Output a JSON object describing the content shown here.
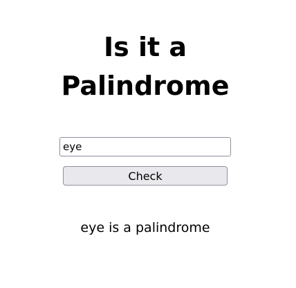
{
  "page": {
    "title_line1": "Is it a",
    "title_line2": "Palindrome"
  },
  "form": {
    "input_value": "eye",
    "check_label": "Check"
  },
  "result": {
    "text": "eye is a palindrome"
  },
  "colors": {
    "background": "#ffffff",
    "text": "#000000",
    "button_bg": "#e9e9ed",
    "border": "#8f8f9d"
  }
}
